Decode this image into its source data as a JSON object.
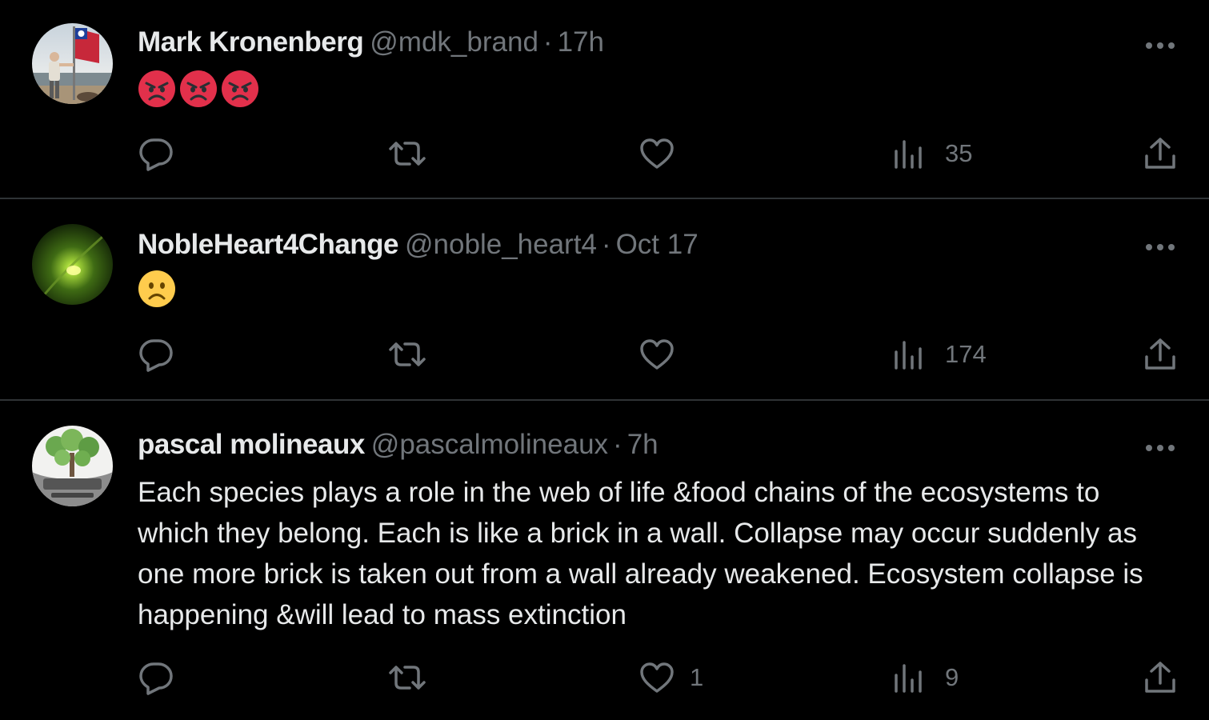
{
  "tweets": [
    {
      "name": "Mark Kronenberg",
      "handle": "@mdk_brand",
      "separator": "·",
      "time": "17h",
      "emojis": [
        "angry-face",
        "angry-face",
        "angry-face"
      ],
      "text": "",
      "likes": "",
      "views": "35"
    },
    {
      "name": "NobleHeart4Change",
      "handle": "@noble_heart4",
      "separator": "·",
      "time": "Oct 17",
      "emojis": [
        "frowning-face"
      ],
      "text": "",
      "likes": "",
      "views": "174"
    },
    {
      "name": "pascal molineaux",
      "handle": "@pascalmolineaux",
      "separator": "·",
      "time": "7h",
      "emojis": [],
      "text": "Each species plays a role in the web of life &food chains of the ecosystems to which they belong. Each is like a brick in a wall. Collapse may occur suddenly as one more brick is taken out from a wall already weakened. Ecosystem collapse is happening &will lead to mass extinction",
      "likes": "1",
      "views": "9"
    }
  ],
  "colors": {
    "background": "#000000",
    "primary_text": "#e7e9ea",
    "secondary_text": "#71767b",
    "divider": "#2f3336",
    "angry_emoji": "#e2304b",
    "frown_emoji": "#ffcc4d"
  }
}
